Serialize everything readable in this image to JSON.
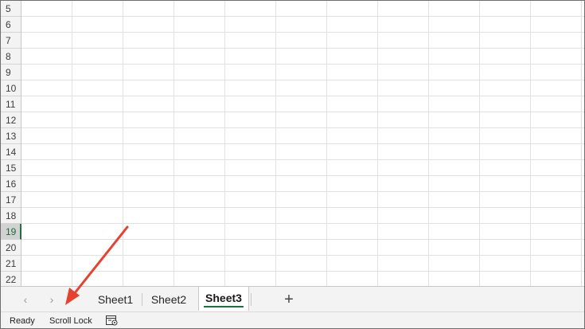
{
  "grid": {
    "rows": [
      {
        "num": "5"
      },
      {
        "num": "6"
      },
      {
        "num": "7"
      },
      {
        "num": "8"
      },
      {
        "num": "9"
      },
      {
        "num": "10"
      },
      {
        "num": "11"
      },
      {
        "num": "12"
      },
      {
        "num": "13"
      },
      {
        "num": "14"
      },
      {
        "num": "15"
      },
      {
        "num": "16"
      },
      {
        "num": "17"
      },
      {
        "num": "18"
      },
      {
        "num": "19"
      },
      {
        "num": "20"
      },
      {
        "num": "21"
      },
      {
        "num": "22"
      }
    ],
    "selected_row": "19"
  },
  "tabs": {
    "prev_icon": "chevron-left-icon",
    "next_icon": "chevron-right-icon",
    "sheets": [
      {
        "label": "Sheet1",
        "active": false
      },
      {
        "label": "Sheet2",
        "active": false
      },
      {
        "label": "Sheet3",
        "active": true
      }
    ],
    "add_label": "+"
  },
  "status": {
    "ready": "Ready",
    "scroll_lock": "Scroll Lock",
    "accessibility_icon": "page-settings-icon"
  },
  "colors": {
    "accent": "#1e7145",
    "annotation": "#e8402f"
  }
}
